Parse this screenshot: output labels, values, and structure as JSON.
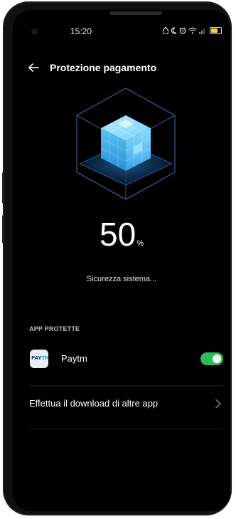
{
  "status_bar": {
    "time": "15:20",
    "icons": [
      "water-drop-icon",
      "moon-icon",
      "alarm-icon",
      "wifi-icon",
      "signal-icon",
      "battery-icon"
    ],
    "battery_color": "#f2d43b"
  },
  "header": {
    "back_icon": "back-arrow-icon",
    "title": "Protezione pagamento"
  },
  "security": {
    "score": "50",
    "unit": "%",
    "progress": 0.5,
    "status_text": "Sicurezza sistema..."
  },
  "protected_apps": {
    "section_title": "APP PROTETTE",
    "items": [
      {
        "name": "Paytm",
        "icon": "paytm-app-icon",
        "icon_text_a": "PAY",
        "icon_text_b": "TM",
        "enabled": true
      }
    ]
  },
  "download_more": {
    "label": "Effettua il download di altre app",
    "icon": "chevron-right-icon"
  },
  "colors": {
    "background": "#000000",
    "toggle_on": "#2ebd5c",
    "cube_accent": "#4fc3f7"
  }
}
